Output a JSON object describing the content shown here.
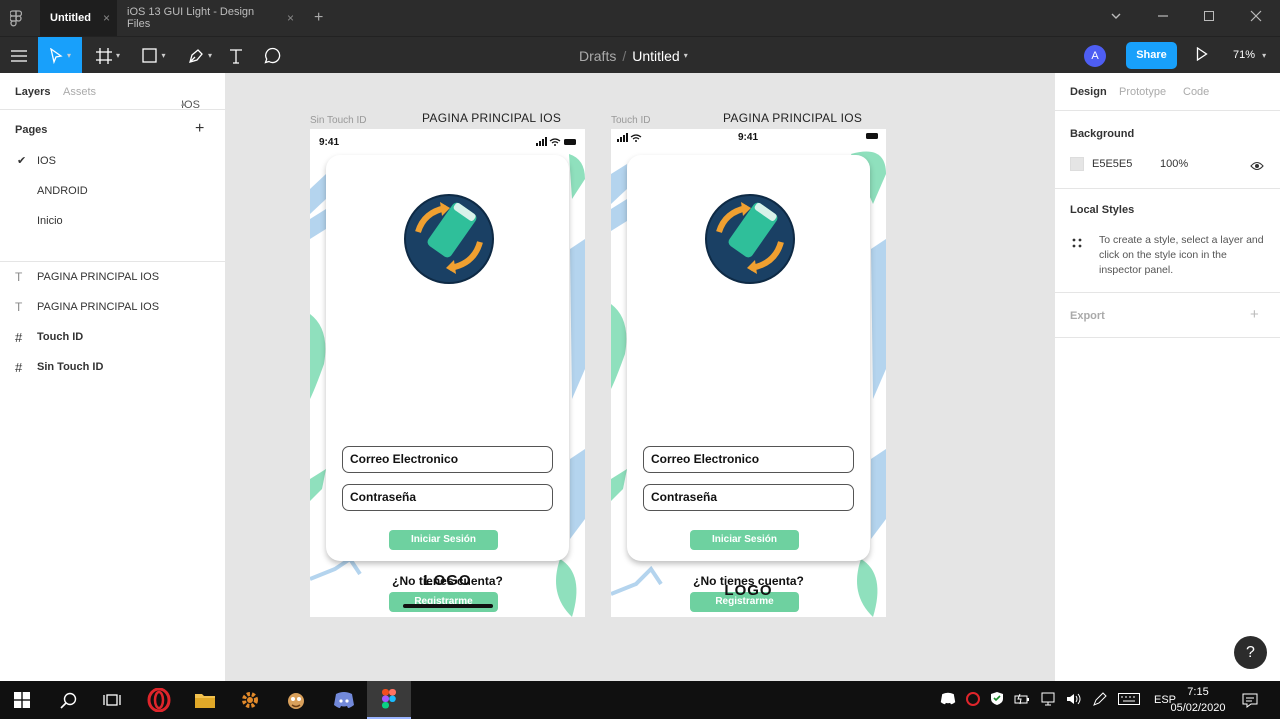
{
  "titlebar": {
    "tabs": [
      {
        "label": "Untitled",
        "active": true
      },
      {
        "label": "iOS 13 GUI Light - Design Files",
        "active": false
      }
    ],
    "close_glyph": "×",
    "add_glyph": "+"
  },
  "toolbar": {
    "breadcrumb_parent": "Drafts",
    "breadcrumb_sep": "/",
    "file_name": "Untitled",
    "avatar_initial": "A",
    "share_label": "Share",
    "zoom": "71%"
  },
  "left_panel": {
    "tab_layers": "Layers",
    "tab_assets": "Assets",
    "page_selector": "IOS",
    "pages_title": "Pages",
    "pages": [
      "IOS",
      "ANDROID",
      "Inicio"
    ],
    "selected_page": "IOS",
    "layers": [
      {
        "type": "text",
        "label": "PAGINA PRINCIPAL IOS"
      },
      {
        "type": "text",
        "label": "PAGINA PRINCIPAL IOS"
      },
      {
        "type": "frame",
        "label": "Touch ID"
      },
      {
        "type": "frame",
        "label": "Sin Touch ID"
      }
    ]
  },
  "canvas": {
    "background": "#E5E5E5",
    "frames": [
      {
        "frame_label": "Sin Touch ID",
        "title": "PAGINA PRINCIPAL IOS",
        "time": "9:41",
        "email_placeholder": "Correo Electronico",
        "password_placeholder": "Contraseña",
        "login_label": "Iniciar Sesión",
        "question": "¿No tienes cuenta?",
        "register_label": "Registrarme",
        "logo_text": "LOGO"
      },
      {
        "frame_label": "Touch ID",
        "title": "PAGINA PRINCIPAL IOS",
        "time": "9:41",
        "email_placeholder": "Correo Electronico",
        "password_placeholder": "Contraseña",
        "login_label": "Iniciar Sesión",
        "question": "¿No tienes cuenta?",
        "register_label": "Registrarme",
        "logo_text": "LOGO"
      }
    ],
    "accent_green": "#6ED1A0",
    "accent_blue": "#B4D4EE"
  },
  "right_panel": {
    "tab_design": "Design",
    "tab_prototype": "Prototype",
    "tab_code": "Code",
    "background_title": "Background",
    "background_hex": "E5E5E5",
    "background_opacity": "100%",
    "local_styles_title": "Local Styles",
    "local_styles_help": "To create a style, select a layer and click on the style icon in the inspector panel.",
    "export_title": "Export",
    "help_glyph": "?"
  },
  "taskbar": {
    "language": "ESP",
    "time": "7:15",
    "date": "05/02/2020"
  }
}
